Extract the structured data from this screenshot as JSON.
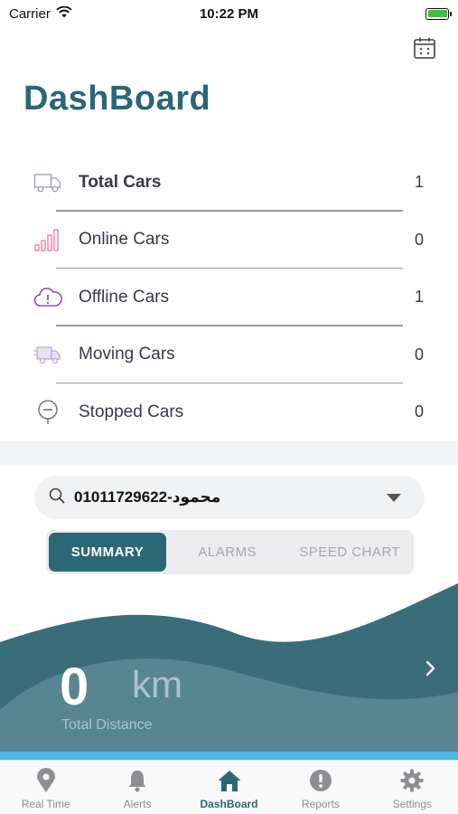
{
  "status_bar": {
    "carrier": "Carrier",
    "time": "10:22 PM"
  },
  "page": {
    "title": "DashBoard"
  },
  "stats": [
    {
      "label": "Total Cars",
      "value": "1",
      "icon": "truck-icon"
    },
    {
      "label": "Online Cars",
      "value": "0",
      "icon": "signal-bars-icon"
    },
    {
      "label": "Offline Cars",
      "value": "1",
      "icon": "cloud-alert-icon"
    },
    {
      "label": "Moving Cars",
      "value": "0",
      "icon": "moving-truck-icon"
    },
    {
      "label": "Stopped Cars",
      "value": "0",
      "icon": "stop-pin-icon"
    }
  ],
  "selector": {
    "value": "01011729622-محمود"
  },
  "tabs": [
    {
      "label": "SUMMARY",
      "active": true
    },
    {
      "label": "ALARMS",
      "active": false
    },
    {
      "label": "SPEED CHART",
      "active": false
    }
  ],
  "summary": {
    "distance_value": "0",
    "distance_unit": "km",
    "distance_label": "Total Distance"
  },
  "tabbar": [
    {
      "label": "Real Time",
      "icon": "location-pin-icon"
    },
    {
      "label": "Alerts",
      "icon": "bell-icon"
    },
    {
      "label": "DashBoard",
      "icon": "home-icon",
      "active": true
    },
    {
      "label": "Reports",
      "icon": "exclamation-circle-icon"
    },
    {
      "label": "Settings",
      "icon": "gear-icon"
    }
  ],
  "colors": {
    "brand": "#2b6775",
    "wave_dark": "#3a6c79",
    "wave_light": "#5e8a96",
    "accent_strip": "#4cb6e8",
    "online_icon": "#e57b96",
    "offline_icon": "#9a4fb0"
  }
}
